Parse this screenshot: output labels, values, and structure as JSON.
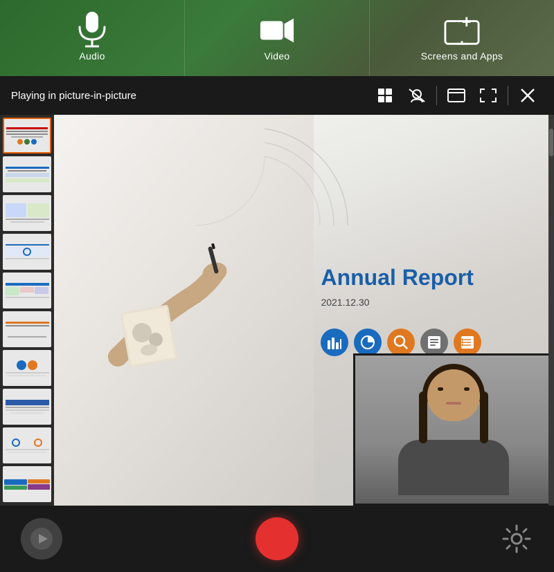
{
  "toolbar": {
    "items": [
      {
        "id": "audio",
        "label": "Audio"
      },
      {
        "id": "video",
        "label": "Video"
      },
      {
        "id": "screens-apps",
        "label": "Screens and Apps"
      }
    ]
  },
  "pip_bar": {
    "status_text": "Playing in picture-in-picture"
  },
  "slide": {
    "title": "Annual Report",
    "date": "2021.12.30"
  },
  "bottom_bar": {
    "record_label": "Record",
    "settings_label": "Settings"
  },
  "pip_controls": [
    {
      "id": "pip-grid",
      "label": "Grid"
    },
    {
      "id": "pip-no-video",
      "label": "No Video"
    },
    {
      "id": "pip-window",
      "label": "Window"
    },
    {
      "id": "pip-fullscreen",
      "label": "Fullscreen"
    },
    {
      "id": "pip-close",
      "label": "Close"
    }
  ]
}
